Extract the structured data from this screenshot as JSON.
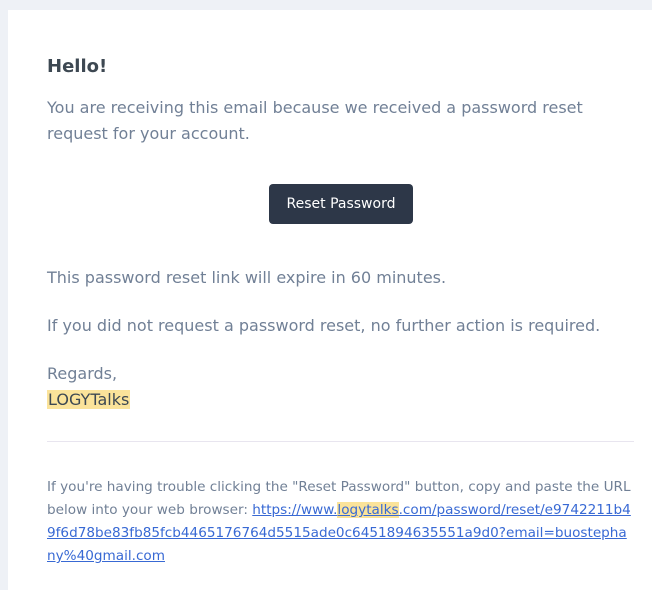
{
  "email": {
    "greeting": "Hello!",
    "intro": "You are receiving this email because we received a password reset request for your account.",
    "button_label": "Reset Password",
    "expire_text": "This password reset link will expire in 60 minutes.",
    "no_action_text": "If you did not request a password reset, no further action is required.",
    "regards": "Regards,",
    "brand": "LOGYTalks",
    "subcopy_text": "If you're having trouble clicking the \"Reset Password\" button, copy and paste the URL below into your web browser: ",
    "url_prefix": "https://www.",
    "url_highlight": "logytalks",
    "url_suffix": ".com/password/reset/e9742211b49f6d78be83fb85fcb4465176764d5515ade0c6451894635551a9d0?email=buostephany%40gmail.com"
  },
  "colors": {
    "button_bg": "#2d3748",
    "text": "#718096",
    "heading": "#3d4852",
    "link": "#3869d4",
    "highlight": "#fbe39a"
  }
}
